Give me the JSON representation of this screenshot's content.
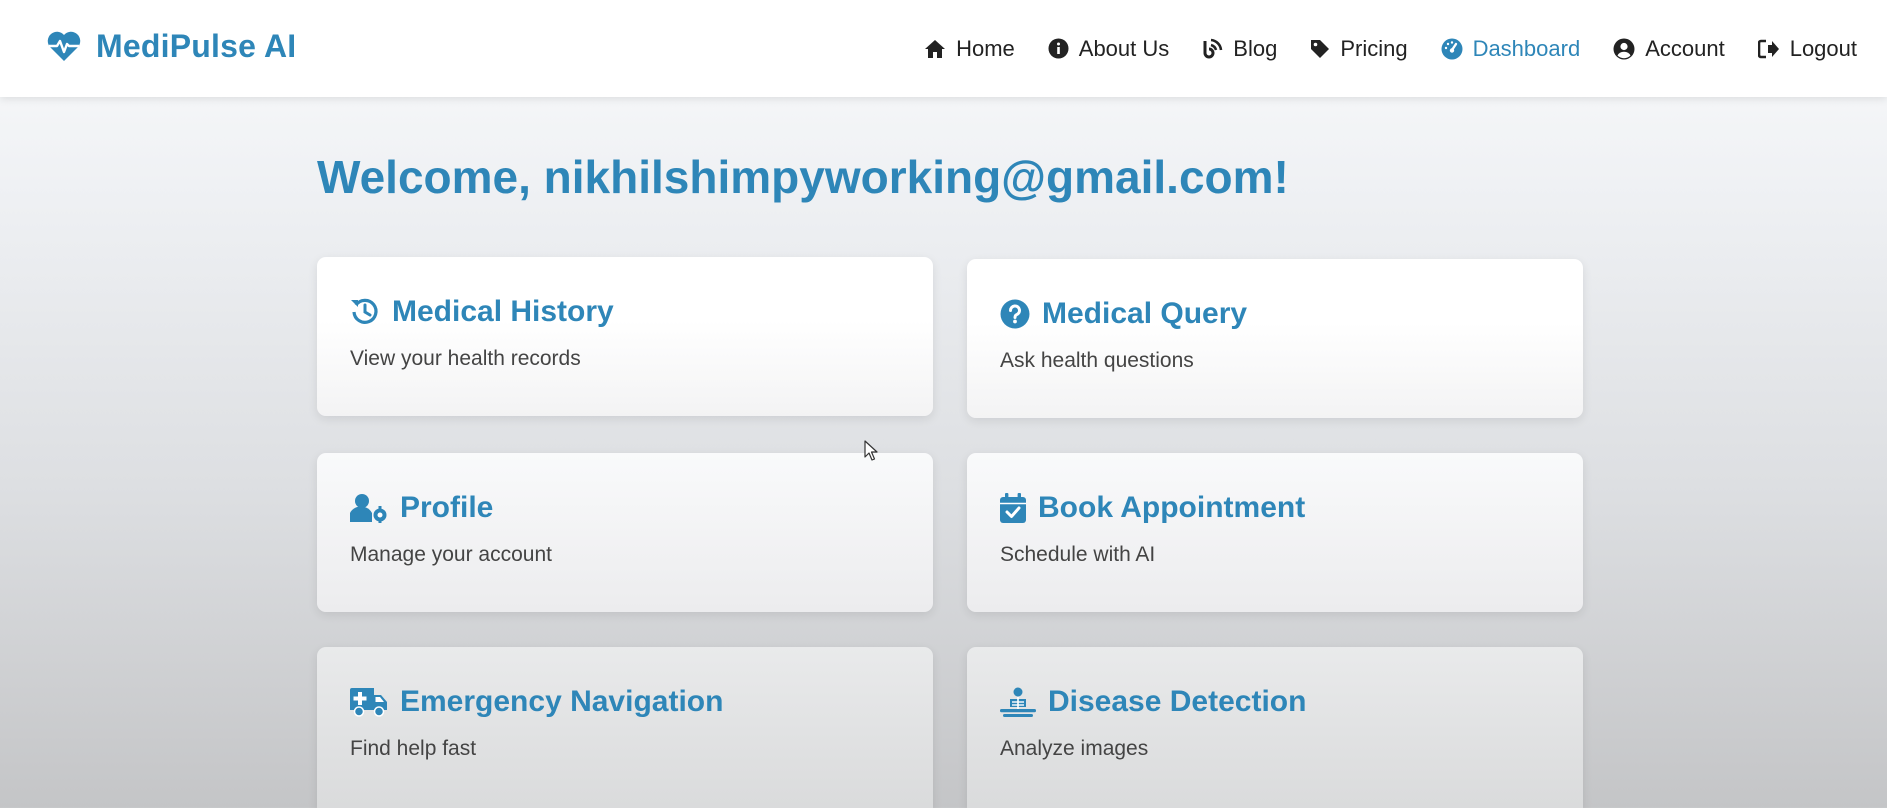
{
  "brand": {
    "name": "MediPulse AI",
    "icon": "heart-pulse-icon",
    "color": "#2e86b8"
  },
  "nav": {
    "items": [
      {
        "label": "Home",
        "icon": "home-icon"
      },
      {
        "label": "About Us",
        "icon": "info-icon"
      },
      {
        "label": "Blog",
        "icon": "blog-icon"
      },
      {
        "label": "Pricing",
        "icon": "tag-icon"
      },
      {
        "label": "Dashboard",
        "icon": "dashboard-icon",
        "active": true
      },
      {
        "label": "Account",
        "icon": "user-circle-icon"
      },
      {
        "label": "Logout",
        "icon": "logout-icon"
      }
    ],
    "active_color": "#2e86b8"
  },
  "welcome": {
    "text": "Welcome, nikhilshimpyworking@gmail.com!"
  },
  "cards": [
    {
      "title": "Medical History",
      "description": "View your health records",
      "icon": "history-icon"
    },
    {
      "title": "Medical Query",
      "description": "Ask health questions",
      "icon": "question-circle-icon"
    },
    {
      "title": "Profile",
      "description": "Manage your account",
      "icon": "user-cog-icon"
    },
    {
      "title": "Book Appointment",
      "description": "Schedule with AI",
      "icon": "calendar-check-icon"
    },
    {
      "title": "Emergency Navigation",
      "description": "Find help fast",
      "icon": "ambulance-icon"
    },
    {
      "title": "Disease Detection",
      "description": "Analyze images",
      "icon": "x-ray-icon"
    }
  ]
}
